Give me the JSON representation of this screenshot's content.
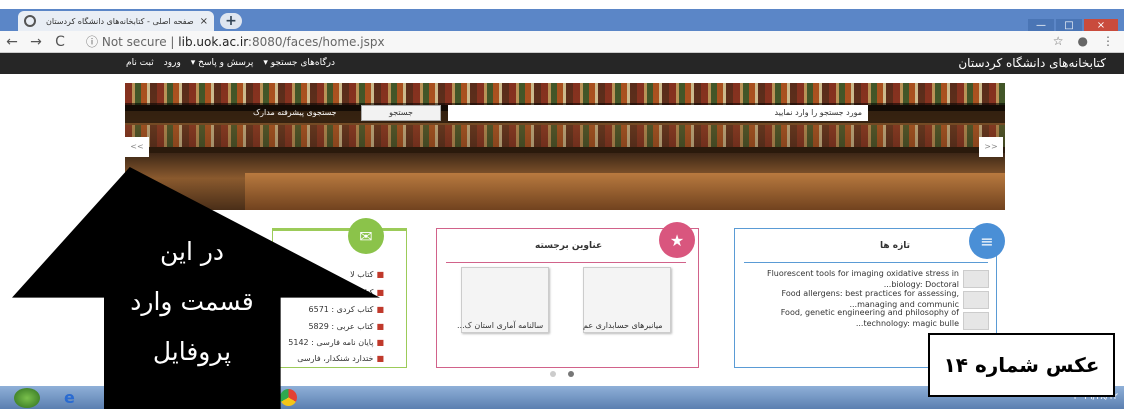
{
  "browser": {
    "tab_title": "صفحه اصلی - کتابخانه‌های دانشگاه کردستان",
    "tab_close": "×",
    "new_tab": "+",
    "url_security": "Not secure",
    "url_separator": "|",
    "url_host": "lib.uok.ac.ir",
    "url_path": ":8080/faces/home.jspx",
    "nav_back": "←",
    "nav_forward": "→",
    "nav_reload": "C",
    "info_icon": "ⓘ",
    "star_icon": "☆",
    "account_icon": "●",
    "menu_icon": "⋮",
    "win_minimize": "—",
    "win_maximize": "□",
    "win_close": "×"
  },
  "site": {
    "title": "کتابخانه‌های دانشگاه کردستان",
    "nav": {
      "portals": "درگاه‌های جستجو ▾",
      "qa": "پرسش و پاسخ ▾",
      "login": "ورود",
      "register": "ثبت نام"
    }
  },
  "search": {
    "placeholder": "مورد جستجو را وارد نمایید",
    "button": "جستجو",
    "advanced": "جستجوی پیشرفته مدارک"
  },
  "slider": {
    "prev": "<<",
    "next": ">>"
  },
  "cards": {
    "stats": {
      "icon": "✉",
      "lines": [
        "کتاب لا",
        "کتاب فا",
        "کتاب کردی : 6571",
        "کتاب عربی : 5829",
        "پایان نامه فارسی : 5142",
        "ختدارد شنکدار، فارسی"
      ]
    },
    "featured": {
      "icon": "★",
      "title": "عناوین برجسته",
      "items": [
        "میانبرهای حسابداری عم",
        "سالنامه آماری استان ک..."
      ]
    },
    "new": {
      "icon": "≡",
      "title": "تازه ها",
      "items": [
        "Fluorescent tools for imaging oxidative stress in ...biology: Doctoral",
        "Food allergens: best practices for assessing, ...managing and communic",
        "Food, genetic engineering and philosophy of ...technology: magic bulle"
      ]
    }
  },
  "annotation": {
    "arrow_text_1": "در این",
    "arrow_text_2": "قسمت وارد",
    "arrow_text_3": "پروفایل",
    "caption": "عکس شماره ۱۴"
  },
  "taskbar": {
    "clock": "۲۰۱۹/۳۸/۱۲"
  }
}
